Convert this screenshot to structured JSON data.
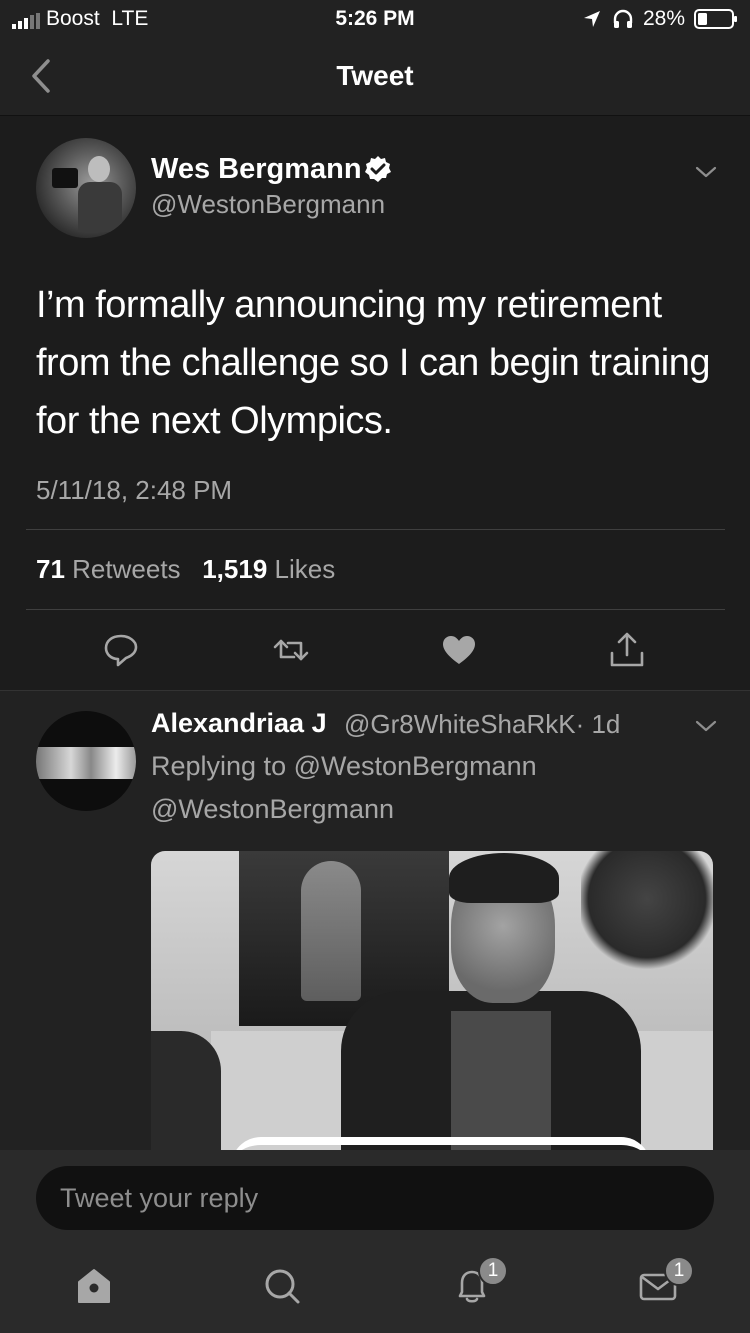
{
  "status_bar": {
    "carrier": "Boost",
    "network": "LTE",
    "time": "5:26 PM",
    "battery": "28%",
    "battery_level": 0.28
  },
  "nav": {
    "title": "Tweet",
    "back_icon": "chevron-left-icon"
  },
  "tweet": {
    "author_name": "Wes Bergmann",
    "author_handle": "@WestonBergmann",
    "verified": true,
    "text": "I’m formally announcing my retirement from the challenge so I can begin training for the next Olympics.",
    "timestamp": "5/11/18, 2:48 PM",
    "retweets_count": "71",
    "retweets_label": "Retweets",
    "likes_count": "1,519",
    "likes_label": "Likes",
    "actions": [
      "reply-icon",
      "retweet-icon",
      "like-icon",
      "share-icon"
    ]
  },
  "reply": {
    "author_name": "Alexandriaa J",
    "author_handle": "@Gr8WhiteShaRkK",
    "age": "· 1d",
    "replying_to": "Replying to @WestonBergmann",
    "mention": "@WestonBergmann"
  },
  "compose": {
    "placeholder": "Tweet your reply"
  },
  "tabbar": {
    "tabs": [
      {
        "name": "home",
        "icon": "home-icon",
        "badge": ""
      },
      {
        "name": "search",
        "icon": "search-icon",
        "badge": ""
      },
      {
        "name": "notifications",
        "icon": "bell-icon",
        "badge": "1"
      },
      {
        "name": "messages",
        "icon": "mail-icon",
        "badge": "1"
      }
    ]
  },
  "colors": {
    "background": "#222222",
    "tweet_background": "#1c1c1c",
    "secondary_text": "#a7a7a7",
    "text": "#ffffff"
  }
}
